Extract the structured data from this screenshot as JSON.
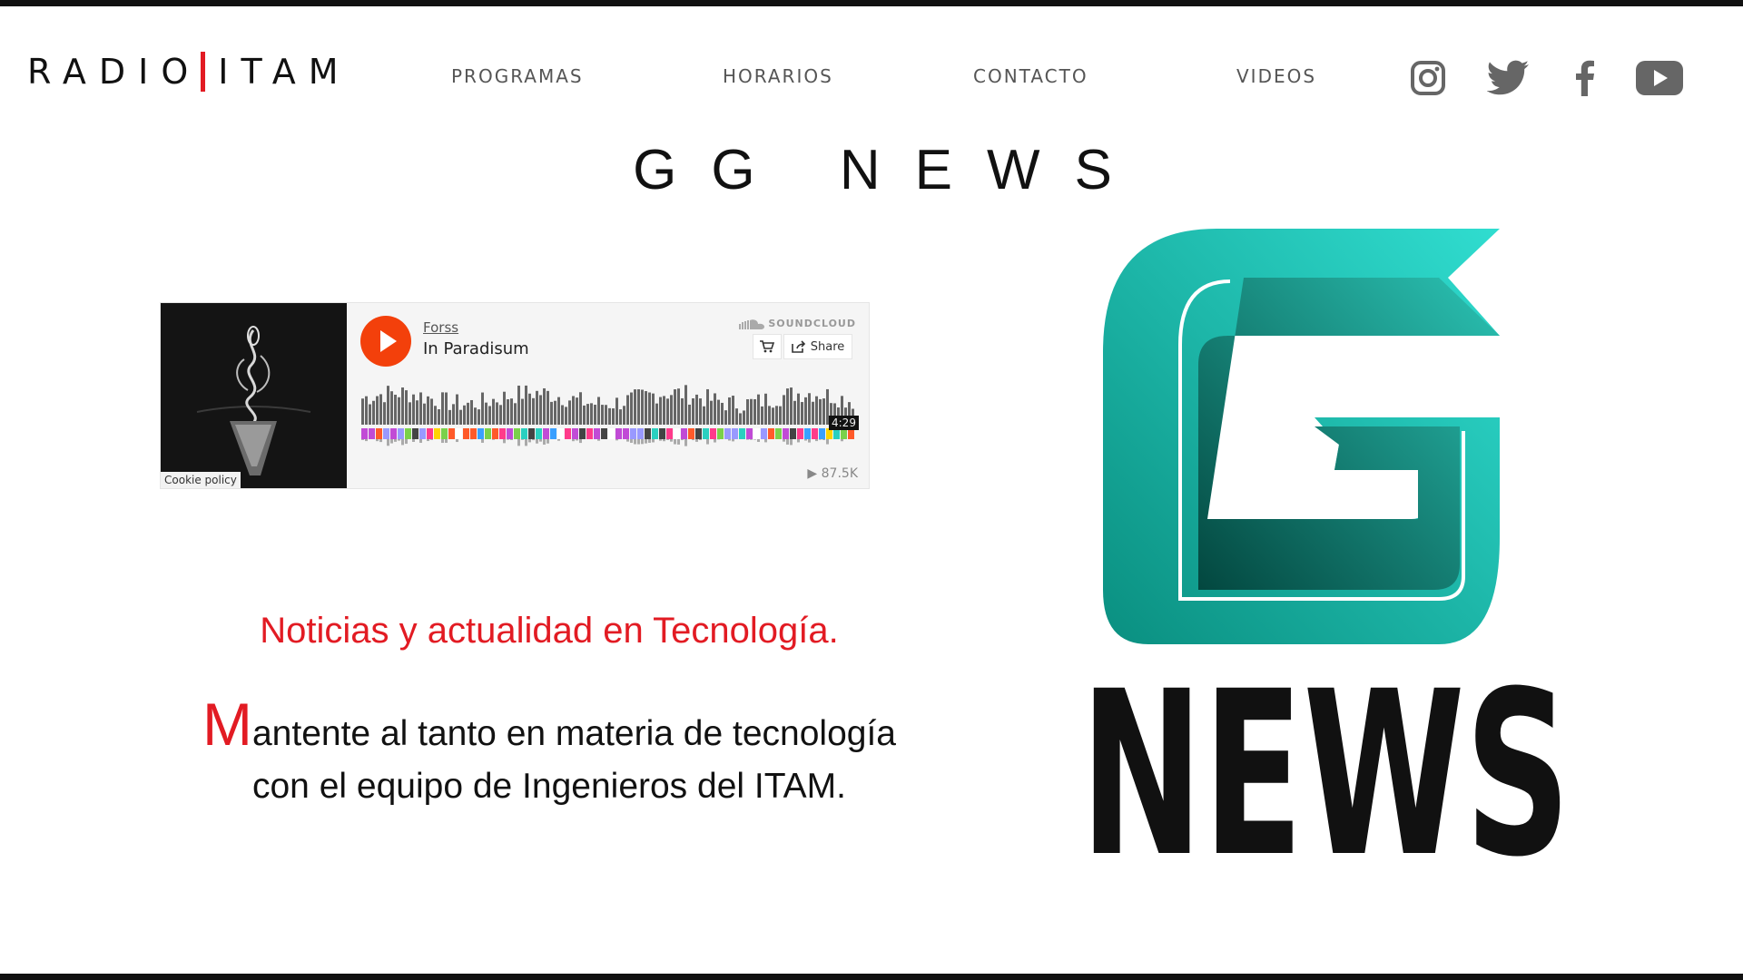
{
  "header": {
    "logo": {
      "left": "RADIO",
      "right": "ITAM"
    },
    "nav": [
      "PROGRAMAS",
      "HORARIOS",
      "CONTACTO",
      "VIDEOS"
    ],
    "social_icons": [
      "instagram-icon",
      "twitter-icon",
      "facebook-icon",
      "youtube-icon"
    ]
  },
  "page": {
    "title": "GG NEWS",
    "tagline": "Noticias y actualidad en Tecnología.",
    "description": {
      "dropcap": "M",
      "line1": "antente al tanto en materia de tecnología",
      "line2": "con el equipo de Ingenieros del ITAM."
    }
  },
  "player": {
    "artist": "Forss",
    "track": "In Paradisum",
    "brand": "SOUNDCLOUD",
    "share_label": "Share",
    "duration": "4:29",
    "plays": "87.5K",
    "cookie": "Cookie policy"
  },
  "brand_logo": {
    "text": "NEWS"
  },
  "colors": {
    "accent": "#e21b23",
    "soundcloud": "#f3400b",
    "teal_light": "#2ed9c9",
    "teal_dark": "#05544a"
  }
}
